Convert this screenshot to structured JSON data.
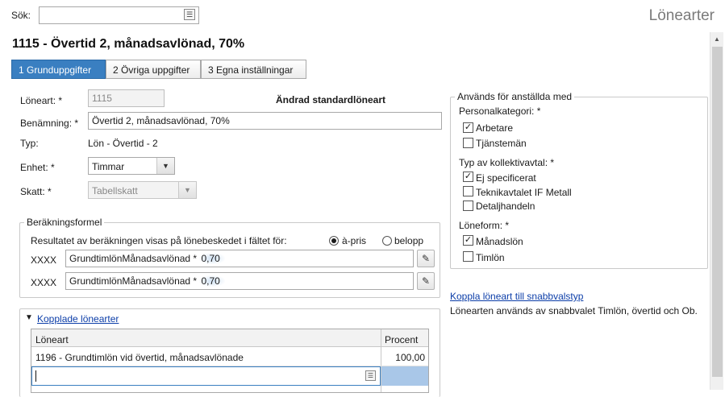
{
  "search": {
    "label": "Sök:",
    "value": ""
  },
  "app_title": "Lönearter",
  "page_title": "1115 - Övertid 2, månadsavlönad, 70%",
  "tabs": [
    {
      "label": "1 Grunduppgifter",
      "active": true
    },
    {
      "label": "2 Övriga uppgifter",
      "active": false
    },
    {
      "label": "3 Egna inställningar",
      "active": false
    }
  ],
  "form": {
    "loneart_label": "Löneart: *",
    "loneart_value": "1115",
    "status_text": "Ändrad standardlöneart",
    "benamning_label": "Benämning: *",
    "benamning_value": "Övertid 2, månadsavlönad, 70%",
    "typ_label": "Typ:",
    "typ_value": "Lön - Övertid - 2",
    "enhet_label": "Enhet: *",
    "enhet_value": "Timmar",
    "skatt_label": "Skatt: *",
    "skatt_value": "Tabellskatt"
  },
  "berakning": {
    "title": "Beräkningsformel",
    "description": "Resultatet av beräkningen visas på lönebeskedet i fältet för:",
    "radio_apris": "à-pris",
    "radio_belopp": "belopp",
    "selected": "apris",
    "rows": [
      {
        "prefix": "XXXX",
        "formula": "GrundtimlönMånadsavlönad * ",
        "factor": "0,70"
      },
      {
        "prefix": "XXXX",
        "formula": "GrundtimlönMånadsavlönad * ",
        "factor": "0,70"
      }
    ]
  },
  "kopplade": {
    "title": "Kopplade lönearter",
    "col_loneart": "Löneart",
    "col_procent": "Procent",
    "rows": [
      {
        "loneart": "1196 - Grundtimlön vid övertid, månadsavlönade",
        "procent": "100,00"
      }
    ]
  },
  "anvands": {
    "title": "Används för anställda med",
    "personalkategori_label": "Personalkategori: *",
    "personalkategori": [
      {
        "label": "Arbetare",
        "checked": true
      },
      {
        "label": "Tjänstemän",
        "checked": false
      }
    ],
    "kollektivavtal_label": "Typ av kollektivavtal: *",
    "kollektivavtal": [
      {
        "label": "Ej specificerat",
        "checked": true
      },
      {
        "label": "Teknikavtalet IF Metall",
        "checked": false
      },
      {
        "label": "Detaljhandeln",
        "checked": false
      }
    ],
    "loneform_label": "Löneform: *",
    "loneform": [
      {
        "label": "Månadslön",
        "checked": true
      },
      {
        "label": "Timlön",
        "checked": false
      }
    ]
  },
  "snabbval": {
    "link": "Koppla löneart till snabbvalstyp",
    "info": "Lönearten används av snabbvalet Timlön, övertid och Ob."
  }
}
